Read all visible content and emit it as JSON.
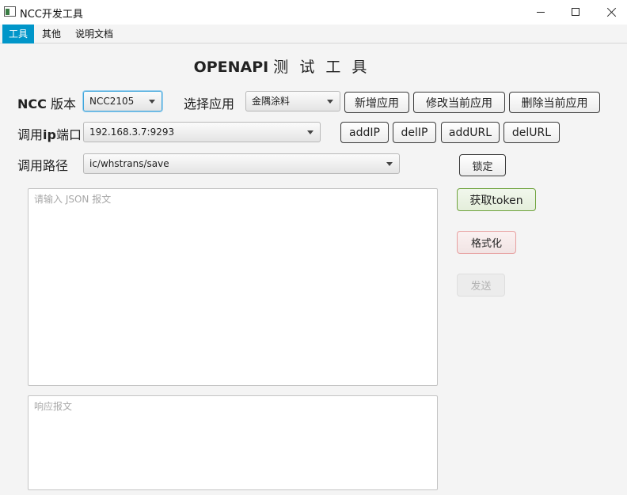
{
  "window": {
    "title": "NCC开发工具"
  },
  "menu": [
    "工具",
    "其他",
    "说明文档"
  ],
  "page_title": {
    "bold": "OPENAPI",
    "light": "测 试 工 具"
  },
  "ncc_version": {
    "label_bold": "NCC",
    "label_rest": " 版本",
    "value": "NCC2105"
  },
  "select_app": {
    "label": "选择应用",
    "value": "金隅涂料"
  },
  "app_buttons": {
    "add": "新增应用",
    "edit": "修改当前应用",
    "delete": "删除当前应用"
  },
  "ip_port": {
    "label_pre": "调用",
    "label_bold": "ip",
    "label_post": "端口",
    "value": "192.168.3.7:9293"
  },
  "ip_buttons": {
    "add_ip": "addIP",
    "del_ip": "delIP",
    "add_url": "addURL",
    "del_url": "delURL"
  },
  "path": {
    "label": "调用路径",
    "value": "ic/whstrans/save"
  },
  "actions": {
    "lock": "锁定",
    "get_token": "获取token",
    "format": "格式化",
    "send": "发送"
  },
  "request": {
    "placeholder": "请输入 JSON 报文"
  },
  "response": {
    "placeholder": "响应报文"
  }
}
